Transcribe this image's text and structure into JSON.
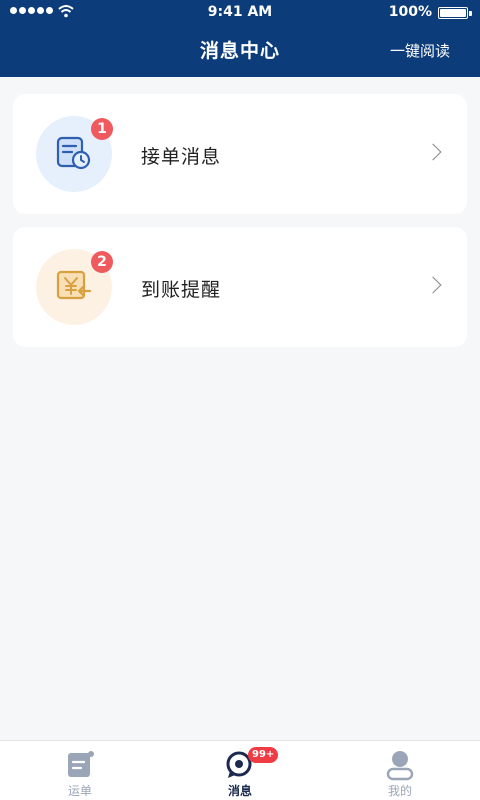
{
  "status_bar": {
    "time": "9:41 AM",
    "battery": "100%",
    "icons": [
      "signal-icon",
      "wifi-icon",
      "battery-icon"
    ]
  },
  "header": {
    "title": "消息中心",
    "action": "一键阅读",
    "background": "#0c3d7a"
  },
  "messages": [
    {
      "label": "接单消息",
      "badge": "1",
      "icon": "order-clock-icon",
      "icon_color": "#2f5fb0"
    },
    {
      "label": "到账提醒",
      "badge": "2",
      "icon": "payment-arrival-icon",
      "icon_color": "#d9a040"
    }
  ],
  "tabbar": {
    "items": [
      {
        "label": "运单",
        "icon": "waybill-icon",
        "active": false
      },
      {
        "label": "消息",
        "icon": "message-icon",
        "active": true,
        "badge": "99+"
      },
      {
        "label": "我的",
        "icon": "profile-icon",
        "active": false
      }
    ]
  }
}
